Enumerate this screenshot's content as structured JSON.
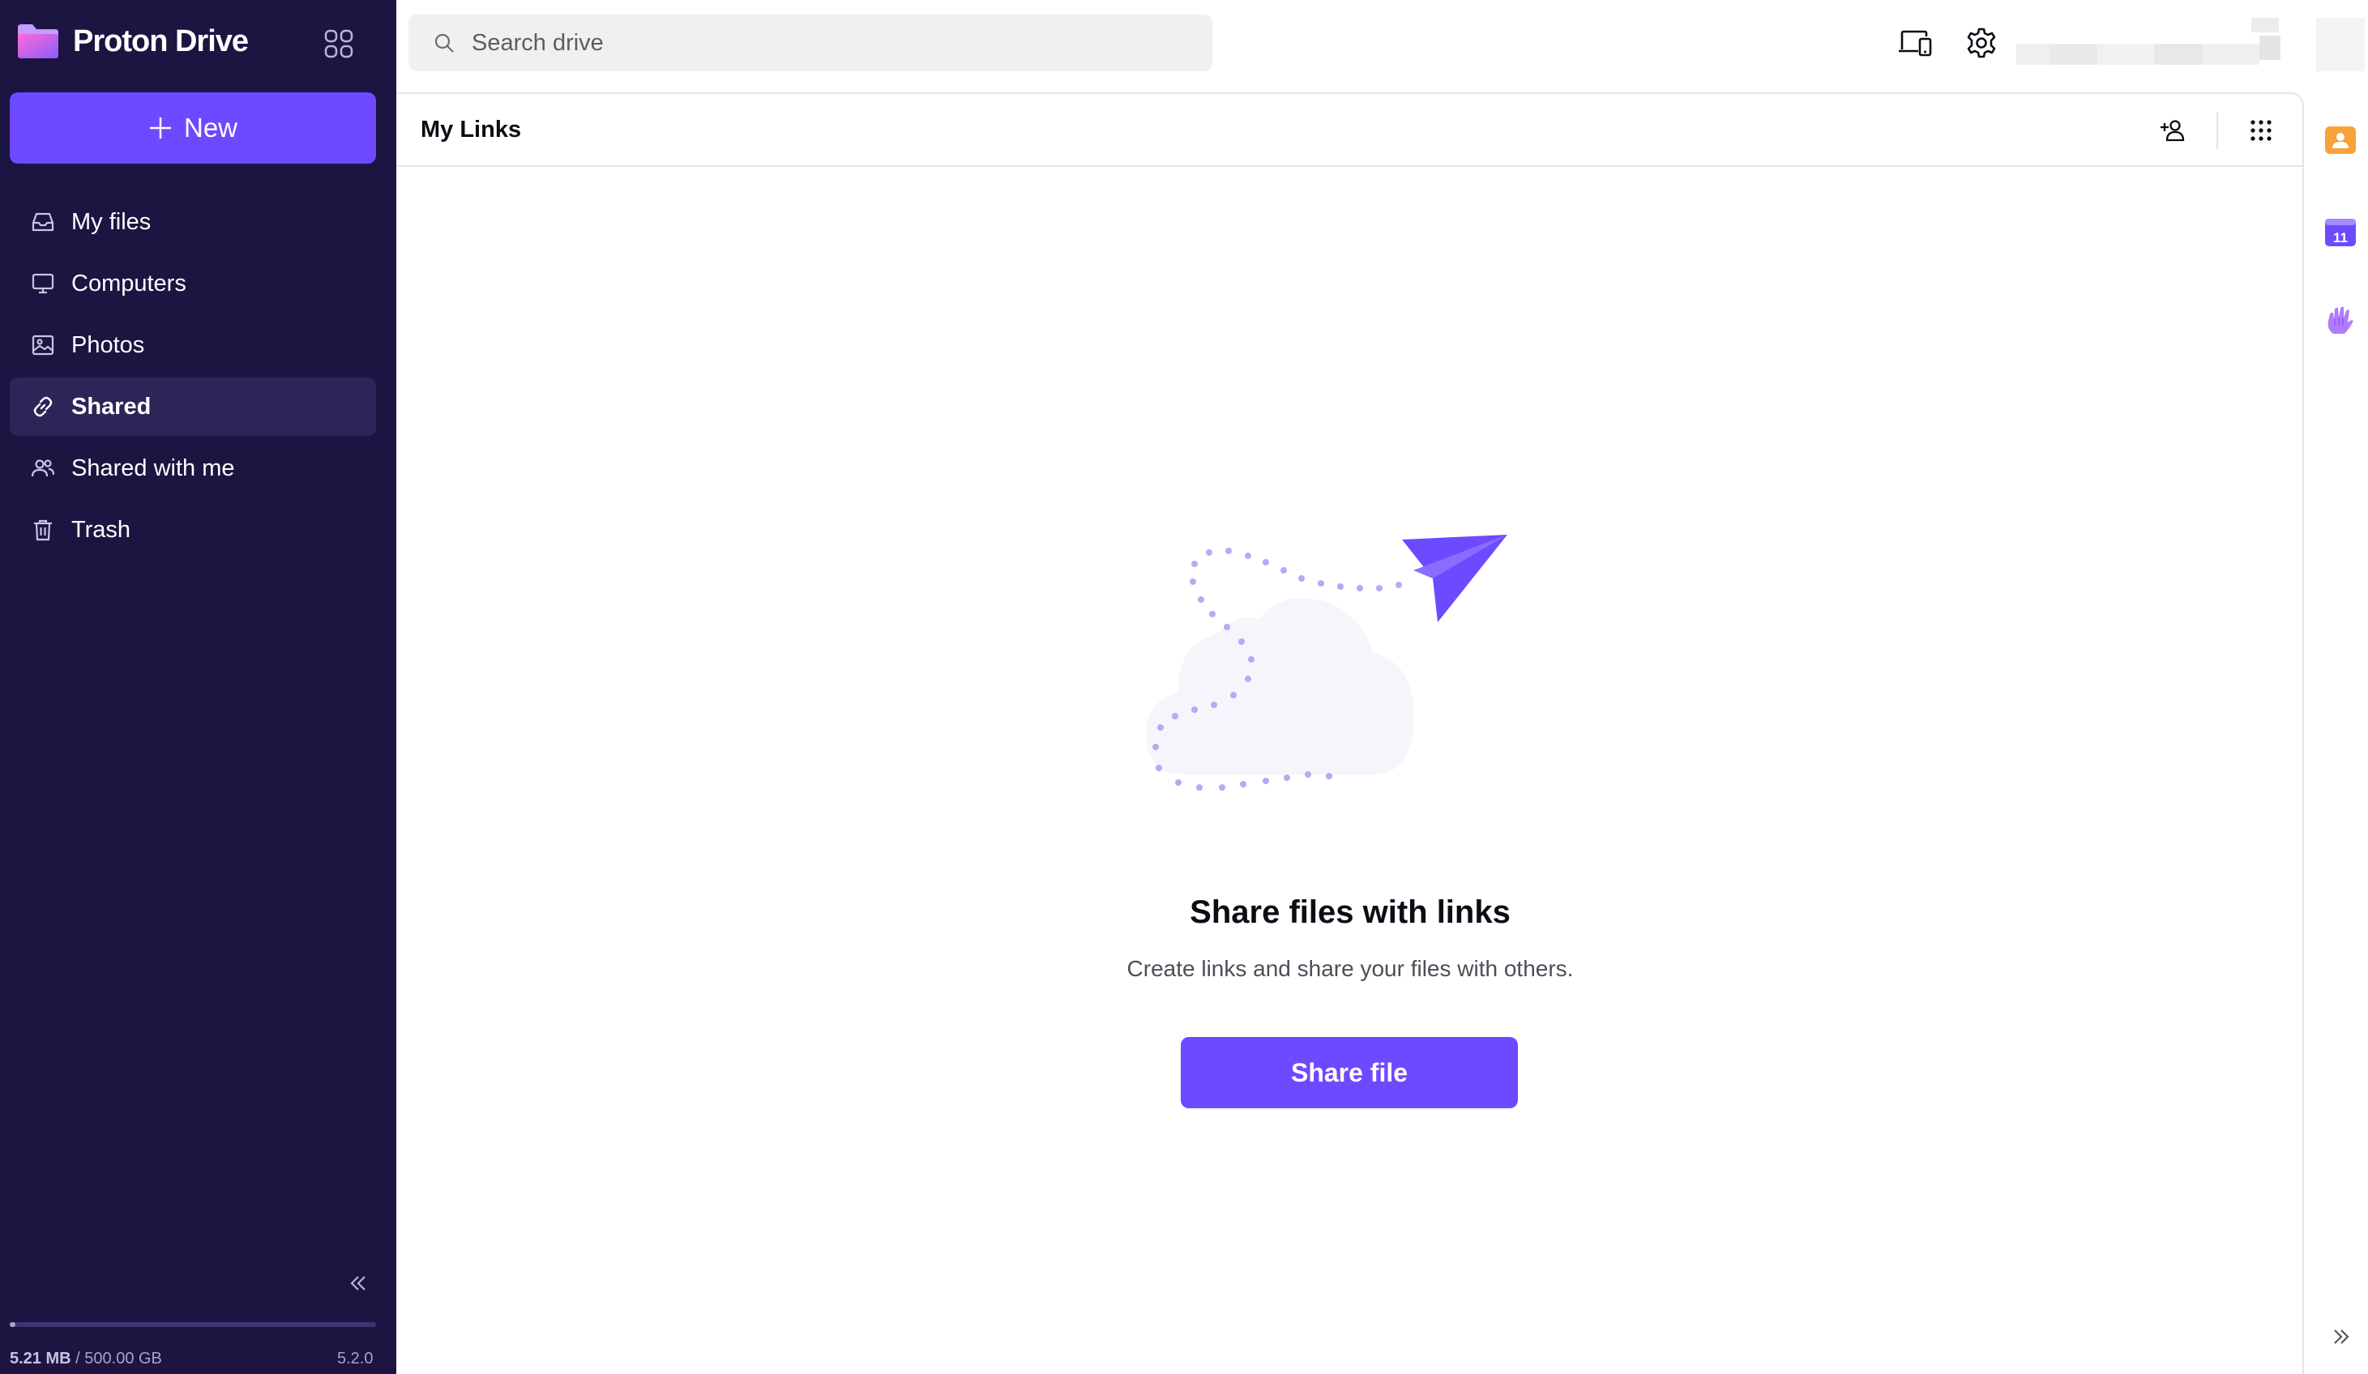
{
  "app": {
    "name": "Proton Drive",
    "brand_color": "#6d4aff",
    "sidebar_bg": "#1c1441"
  },
  "sidebar": {
    "new_button_label": "New",
    "items": [
      {
        "label": "My files",
        "icon": "inbox-icon",
        "active": false
      },
      {
        "label": "Computers",
        "icon": "monitor-icon",
        "active": false
      },
      {
        "label": "Photos",
        "icon": "image-icon",
        "active": false
      },
      {
        "label": "Shared",
        "icon": "link-icon",
        "active": true
      },
      {
        "label": "Shared with me",
        "icon": "users-icon",
        "active": false
      },
      {
        "label": "Trash",
        "icon": "trash-icon",
        "active": false
      }
    ],
    "storage": {
      "used": "5.21 MB",
      "separator": " / ",
      "total": "500.00 GB",
      "used_fraction": 0.01
    },
    "version": "5.2.0"
  },
  "topbar": {
    "search_placeholder": "Search drive"
  },
  "main": {
    "title": "My Links",
    "empty_state": {
      "title": "Share files with links",
      "subtitle": "Create links and share your files with others.",
      "button_label": "Share file"
    }
  },
  "rail": {
    "calendar_day": "11"
  }
}
